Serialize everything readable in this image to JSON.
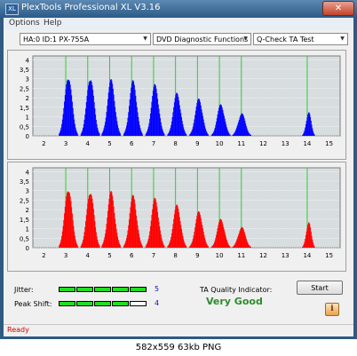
{
  "window": {
    "title": "PlexTools Professional XL V3.16",
    "app_icon_text": "XL",
    "close_label": "✕"
  },
  "menu": {
    "items": [
      "Options",
      "Help"
    ]
  },
  "toolbar": {
    "drive": "HA:0 ID:1  PX-755A",
    "function": "DVD Diagnostic Functions",
    "test": "Q-Check TA Test"
  },
  "chart_data": [
    {
      "type": "bar",
      "name": "upper",
      "color": "#0000ff",
      "x_ticks": [
        "2",
        "3",
        "4",
        "5",
        "6",
        "7",
        "8",
        "9",
        "10",
        "11",
        "12",
        "13",
        "14",
        "15"
      ],
      "y_ticks": [
        "0",
        "0,5",
        "1",
        "1,5",
        "2",
        "2,5",
        "3",
        "3,5",
        "4"
      ],
      "xlim": [
        1.5,
        15.5
      ],
      "ylim": [
        0,
        4.2
      ],
      "grid_marks": [
        3,
        4,
        5,
        6,
        7,
        8,
        9,
        10,
        11,
        14
      ],
      "peaks": [
        {
          "center": 3.1,
          "height": 3.25
        },
        {
          "center": 4.1,
          "height": 3.2
        },
        {
          "center": 5.05,
          "height": 3.0
        },
        {
          "center": 6.05,
          "height": 2.95
        },
        {
          "center": 7.05,
          "height": 2.75
        },
        {
          "center": 8.05,
          "height": 2.3
        },
        {
          "center": 9.05,
          "height": 2.0
        },
        {
          "center": 10.05,
          "height": 1.7
        },
        {
          "center": 11.0,
          "height": 1.2
        },
        {
          "center": 14.05,
          "height": 1.3
        }
      ]
    },
    {
      "type": "bar",
      "name": "lower",
      "color": "#ff0000",
      "x_ticks": [
        "2",
        "3",
        "4",
        "5",
        "6",
        "7",
        "8",
        "9",
        "10",
        "11",
        "12",
        "13",
        "14",
        "15"
      ],
      "y_ticks": [
        "0",
        "0,5",
        "1",
        "1,5",
        "2",
        "2,5",
        "3",
        "3,5",
        "4"
      ],
      "xlim": [
        1.5,
        15.5
      ],
      "ylim": [
        0,
        4.2
      ],
      "grid_marks": [
        3,
        4,
        5,
        6,
        7,
        8,
        9,
        10,
        11,
        14
      ],
      "peaks": [
        {
          "center": 3.1,
          "height": 3.25
        },
        {
          "center": 4.1,
          "height": 3.1
        },
        {
          "center": 5.05,
          "height": 3.0
        },
        {
          "center": 6.05,
          "height": 2.8
        },
        {
          "center": 7.05,
          "height": 2.65
        },
        {
          "center": 8.05,
          "height": 2.3
        },
        {
          "center": 9.05,
          "height": 1.95
        },
        {
          "center": 10.05,
          "height": 1.55
        },
        {
          "center": 11.0,
          "height": 1.1
        },
        {
          "center": 14.05,
          "height": 1.4
        }
      ]
    }
  ],
  "metrics": {
    "jitter_label": "Jitter:",
    "jitter_value": "5",
    "jitter_level": 5,
    "peak_label": "Peak Shift:",
    "peak_value": "4",
    "peak_level": 4,
    "max_level": 5,
    "on_color": "#22dd22",
    "off_color": "#ffffff"
  },
  "ta": {
    "label": "TA Quality Indicator:",
    "value": "Very Good"
  },
  "buttons": {
    "start": "Start",
    "info": "i"
  },
  "status": {
    "text": "Ready"
  },
  "caption": "582x559 63kb PNG"
}
